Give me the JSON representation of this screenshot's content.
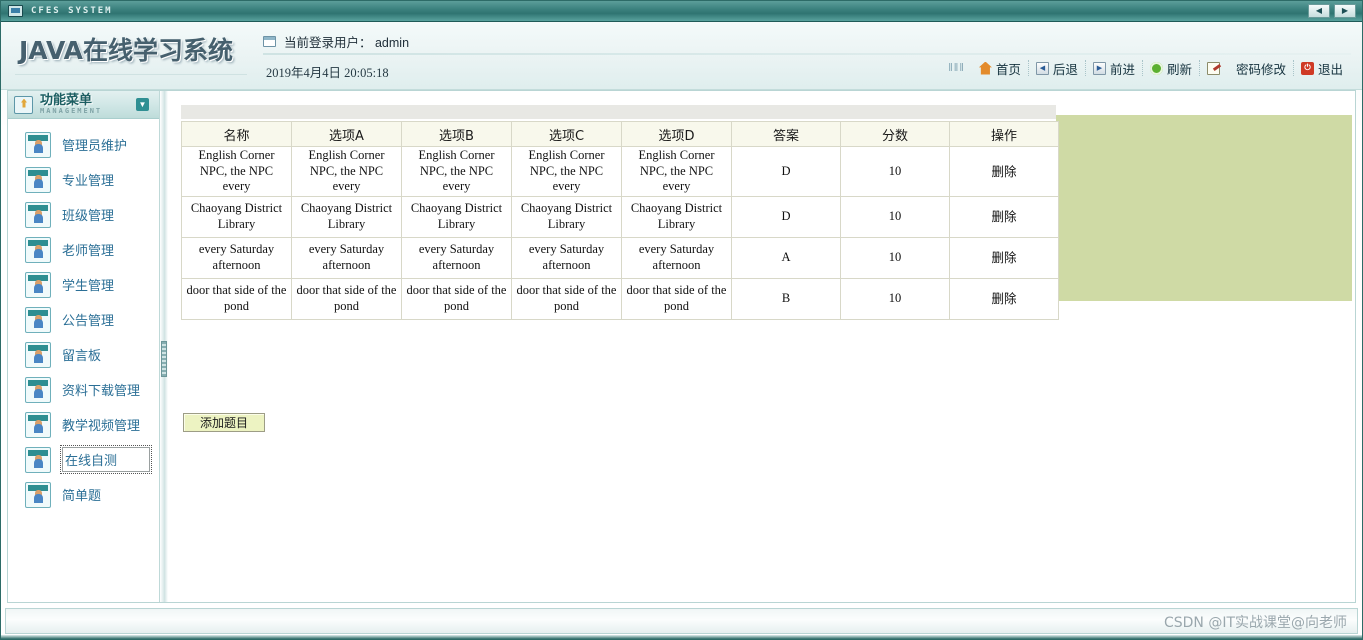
{
  "window": {
    "title": "CFES SYSTEM",
    "icon": "monitor-icon",
    "buttons": {
      "prev": "◀",
      "next": "▶"
    }
  },
  "header": {
    "brand": "JAVA在线学习系统",
    "user_label": "当前登录用户： admin",
    "datetime": "2019年4月4日  20:05:18",
    "logo": "CFES"
  },
  "topnav": {
    "grip": "‖‖‖",
    "items": [
      {
        "label": "首页",
        "icon": "home-icon"
      },
      {
        "label": "后退",
        "icon": "back-arrow-icon"
      },
      {
        "label": "前进",
        "icon": "forward-arrow-icon"
      },
      {
        "label": "刷新",
        "icon": "refresh-icon"
      },
      {
        "label": "密码修改",
        "icon": "edit-note-icon"
      },
      {
        "label": "退出",
        "icon": "exit-icon"
      }
    ]
  },
  "sidebar": {
    "title_cn": "功能菜单",
    "title_en": "MANAGEMENT",
    "collapse_icon": "chevron-down-icon",
    "items": [
      {
        "label": "管理员维护",
        "focused": false
      },
      {
        "label": "专业管理",
        "focused": false
      },
      {
        "label": "班级管理",
        "focused": false
      },
      {
        "label": "老师管理",
        "focused": false
      },
      {
        "label": "学生管理",
        "focused": false
      },
      {
        "label": "公告管理",
        "focused": false
      },
      {
        "label": "留言板",
        "focused": false
      },
      {
        "label": "资料下载管理",
        "focused": false
      },
      {
        "label": "教学视频管理",
        "focused": false
      },
      {
        "label": "在线自测",
        "focused": true
      },
      {
        "label": "简单题",
        "focused": false
      }
    ]
  },
  "main": {
    "table": {
      "columns": [
        "名称",
        "选项A",
        "选项B",
        "选项C",
        "选项D",
        "答案",
        "分数",
        "操作"
      ],
      "rows": [
        {
          "name": "English Corner NPC, the NPC every",
          "optionA": "English Corner NPC, the NPC every",
          "optionB": "English Corner NPC, the NPC every",
          "optionC": "English Corner NPC, the NPC every",
          "optionD": "English Corner NPC, the NPC every",
          "answer": "D",
          "score": "10",
          "action": "删除"
        },
        {
          "name": "Chaoyang District Library",
          "optionA": "Chaoyang District Library",
          "optionB": "Chaoyang District Library",
          "optionC": "Chaoyang District Library",
          "optionD": "Chaoyang District Library",
          "answer": "D",
          "score": "10",
          "action": "删除"
        },
        {
          "name": "every Saturday afternoon",
          "optionA": "every Saturday afternoon",
          "optionB": "every Saturday afternoon",
          "optionC": "every Saturday afternoon",
          "optionD": "every Saturday afternoon",
          "answer": "A",
          "score": "10",
          "action": "删除"
        },
        {
          "name": "door that side of the pond",
          "optionA": "door that side of the pond",
          "optionB": "door that side of the pond",
          "optionC": "door that side of the pond",
          "optionD": "door that side of the pond",
          "answer": "B",
          "score": "10",
          "action": "删除"
        }
      ]
    },
    "add_button": "添加题目"
  },
  "footer": {
    "watermark": "CSDN @IT实战课堂@向老师"
  },
  "colors": {
    "title_bar": "#3d8380",
    "accent": "#2d6b67",
    "olive_panel": "#cfdaa5",
    "table_header": "#f8f8ec",
    "button": "#edf3c2",
    "menu_text": "#2b6f96"
  }
}
